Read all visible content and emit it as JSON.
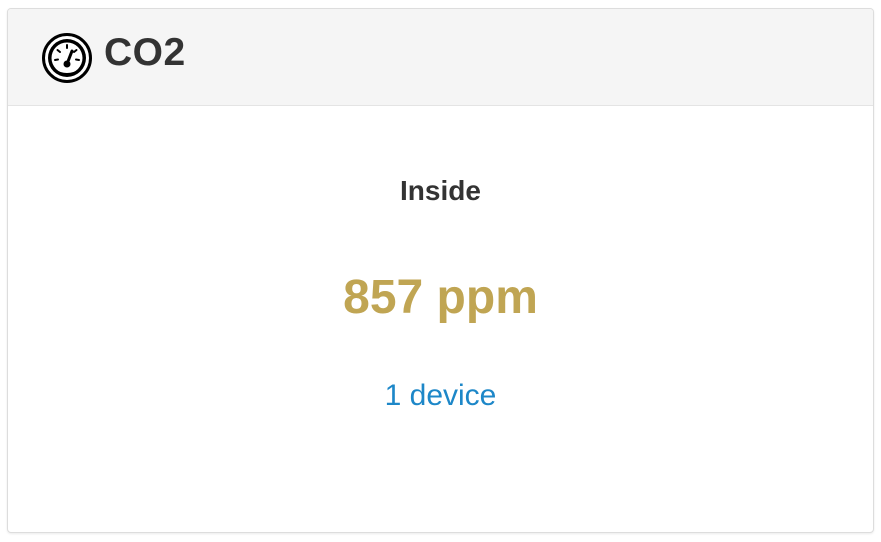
{
  "card": {
    "title": "CO2",
    "icon": "gauge-icon"
  },
  "sensor": {
    "location": "Inside",
    "reading": "857 ppm",
    "devices_link": "1 device"
  },
  "colors": {
    "reading": "#c0a553",
    "link": "#1d87c8",
    "title": "#333333",
    "header_bg": "#f5f5f5"
  }
}
